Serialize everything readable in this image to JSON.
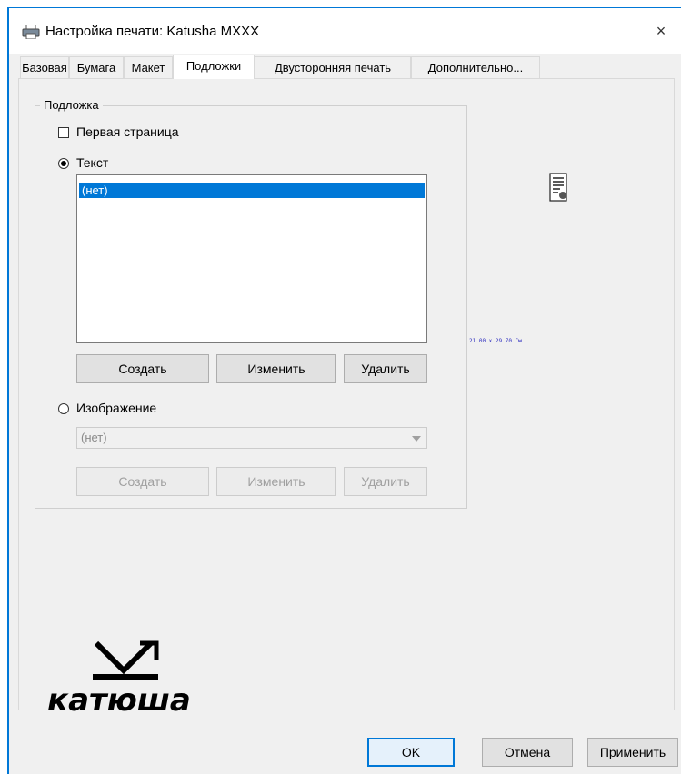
{
  "window": {
    "title": "Настройка печати: Katusha MXXX",
    "close_label": "×"
  },
  "tabs": [
    {
      "label": "Базовая"
    },
    {
      "label": "Бумага"
    },
    {
      "label": "Макет"
    },
    {
      "label": "Подложки",
      "active": true
    },
    {
      "label": "Двусторонняя печать"
    },
    {
      "label": "Дополнительно..."
    }
  ],
  "watermark": {
    "group_label": "Подложка",
    "first_page_label": "Первая страница",
    "first_page_checked": false,
    "text_option_label": "Текст",
    "text_selected": true,
    "text_list": [
      "(нет)"
    ],
    "text_buttons": {
      "create": "Создать",
      "edit": "Изменить",
      "delete": "Удалить"
    },
    "image_option_label": "Изображение",
    "image_selected": false,
    "image_combo_value": "(нет)",
    "image_buttons": {
      "create": "Создать",
      "edit": "Изменить",
      "delete": "Удалить"
    }
  },
  "preview": {
    "size_text": "21.00 x 29.70 См"
  },
  "logo": {
    "text": "катюша"
  },
  "footer": {
    "ok": "OK",
    "cancel": "Отмена",
    "apply": "Применить"
  },
  "colors": {
    "accent": "#0078d7",
    "selection": "#0078d7",
    "background": "#f0f0f0"
  }
}
